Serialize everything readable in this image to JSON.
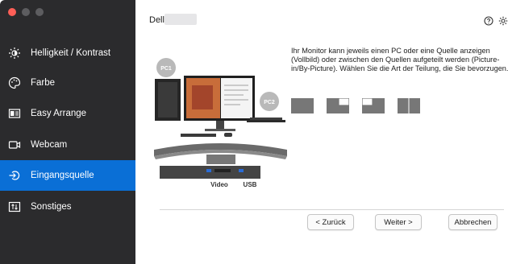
{
  "window": {
    "close_color": "#ff5f57"
  },
  "sidebar": {
    "items": [
      {
        "label": "Helligkeit / Kontrast",
        "icon": "brightness-icon"
      },
      {
        "label": "Farbe",
        "icon": "palette-icon"
      },
      {
        "label": "Easy Arrange",
        "icon": "easy-arrange-icon"
      },
      {
        "label": "Webcam",
        "icon": "webcam-icon"
      },
      {
        "label": "Eingangsquelle",
        "icon": "input-source-icon",
        "active": true
      },
      {
        "label": "Sonstiges",
        "icon": "others-icon"
      }
    ],
    "active_color": "#0a6fd6"
  },
  "header": {
    "brand": "Dell",
    "icons": [
      "help-icon",
      "settings-icon"
    ]
  },
  "main": {
    "description": "Ihr Monitor kann jeweils einen PC oder eine Quelle anzeigen (Vollbild) oder zwischen den Quellen aufgeteilt werden (Picture-in/By-Picture). Wählen Sie die Art der Teilung, die Sie bevorzugen.",
    "layout_options": [
      "full-screen",
      "picture-in-picture-top-right",
      "picture-in-picture-bottom-left",
      "picture-by-picture"
    ],
    "illustration": {
      "pc1_label": "PC1",
      "pc2_label": "PC2",
      "port_labels": [
        "Video",
        "USB"
      ]
    }
  },
  "footer": {
    "back_label": "< Zurück",
    "next_label": "Weiter >",
    "cancel_label": "Abbrechen"
  }
}
